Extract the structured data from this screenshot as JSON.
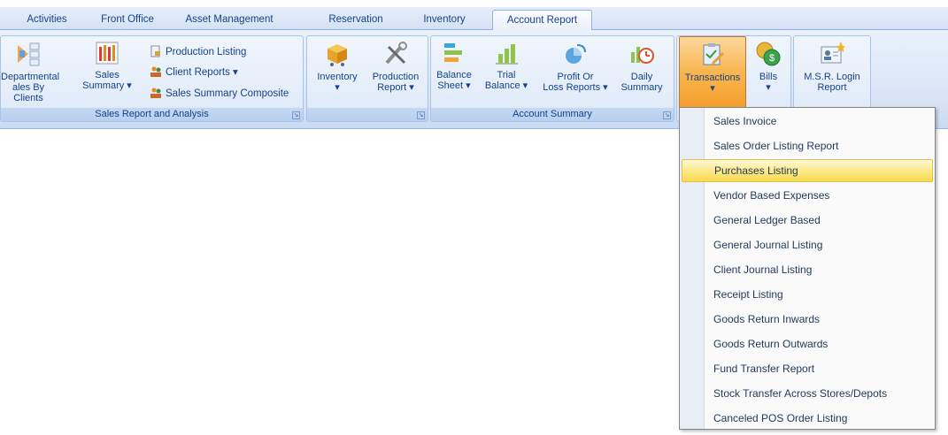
{
  "tabs": [
    {
      "label": "Activities"
    },
    {
      "label": "Front Office"
    },
    {
      "label": "Asset Management"
    },
    {
      "label": "Reservation"
    },
    {
      "label": "Inventory"
    },
    {
      "label": "Account Report"
    }
  ],
  "active_tab": "Account Report",
  "groups": {
    "sales": {
      "label": "Sales Report and Analysis",
      "departmental_line1": "Departmental",
      "departmental_line2": "ales By Clients",
      "sales_summary_line1": "Sales",
      "sales_summary_line2": "Summary ▾",
      "production_listing": "Production Listing",
      "client_reports": "Client Reports ▾",
      "sales_summary_composite": "Sales Summary Composite"
    },
    "inventory": {
      "inventory_line1": "Inventory",
      "inventory_line2": "▾",
      "production_line1": "Production",
      "production_line2": "Report ▾"
    },
    "account": {
      "label": "Account Summary",
      "balance_line1": "Balance",
      "balance_line2": "Sheet ▾",
      "trial_line1": "Trial",
      "trial_line2": "Balance ▾",
      "profit_line1": "Profit Or",
      "profit_line2": "Loss Reports ▾",
      "daily_line1": "Daily",
      "daily_line2": "Summary"
    },
    "misc": {
      "transactions_line1": "Transactions",
      "transactions_line2": "▾",
      "bills_line1": "Bills",
      "bills_line2": "▾",
      "msr_line1": "M.S.R. Login",
      "msr_line2": "Report"
    }
  },
  "menu": {
    "items": [
      {
        "label": "Sales Invoice"
      },
      {
        "label": "Sales Order Listing Report"
      },
      {
        "label": "Purchases Listing"
      },
      {
        "label": "Vendor Based Expenses"
      },
      {
        "label": "General Ledger Based"
      },
      {
        "label": "General Journal Listing"
      },
      {
        "label": "Client Journal Listing"
      },
      {
        "label": "Receipt Listing"
      },
      {
        "label": "Goods Return Inwards"
      },
      {
        "label": "Goods Return Outwards"
      },
      {
        "label": "Fund Transfer Report"
      },
      {
        "label": "Stock Transfer Across Stores/Depots"
      },
      {
        "label": "Canceled POS Order Listing"
      }
    ],
    "highlighted": "Purchases Listing"
  },
  "colors": {
    "accent_pressed": "#f8b54d",
    "highlight": "#fde98a",
    "ribbon_text": "#15428b"
  }
}
